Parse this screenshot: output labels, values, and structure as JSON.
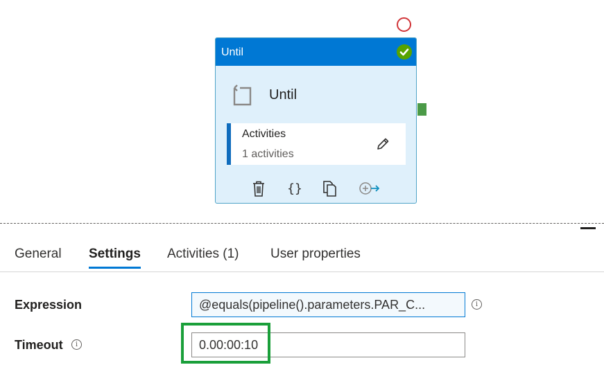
{
  "canvas": {
    "until_card": {
      "header_title": "Until",
      "name": "Until",
      "activities_label": "Activities",
      "activities_count": "1 activities",
      "actions": [
        {
          "name": "delete",
          "icon": "trash-icon"
        },
        {
          "name": "code",
          "icon": "braces-icon"
        },
        {
          "name": "copy",
          "icon": "copy-icon"
        },
        {
          "name": "add-output",
          "icon": "add-arrow-icon"
        }
      ],
      "status": "succeeded",
      "colors": {
        "header": "#0078d4",
        "body": "#dff0fb",
        "accent": "#0f6cbd",
        "success": "#57a300"
      }
    }
  },
  "tabs": [
    {
      "label": "General",
      "active": false
    },
    {
      "label": "Settings",
      "active": true
    },
    {
      "label": "Activities (1)",
      "active": false
    },
    {
      "label": "User properties",
      "active": false
    }
  ],
  "settings": {
    "expression": {
      "label": "Expression",
      "value": "@equals(pipeline().parameters.PAR_C..."
    },
    "timeout": {
      "label": "Timeout",
      "value": "0.00:00:10"
    }
  }
}
